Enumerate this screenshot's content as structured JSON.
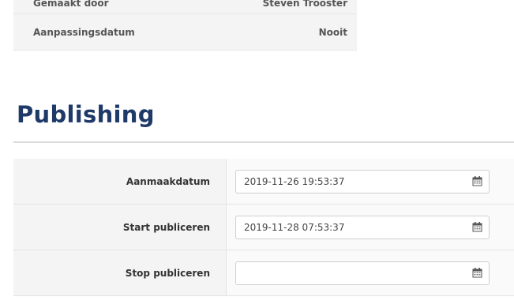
{
  "info": {
    "rows": [
      {
        "label": "Gemaakt door",
        "value": "Steven Trooster"
      },
      {
        "label": "Aanpassingsdatum",
        "value": "Nooit"
      }
    ]
  },
  "publishing": {
    "heading": "Publishing",
    "fields": [
      {
        "label": "Aanmaakdatum",
        "value": "2019-11-26 19:53:37",
        "icon": "calendar-icon"
      },
      {
        "label": "Start publiceren",
        "value": "2019-11-28 07:53:37",
        "icon": "calendar-icon"
      },
      {
        "label": "Stop publiceren",
        "value": "",
        "icon": "calendar-icon"
      }
    ]
  },
  "colors": {
    "heading": "#1f3a68",
    "row_background": "#f4f4f4"
  }
}
